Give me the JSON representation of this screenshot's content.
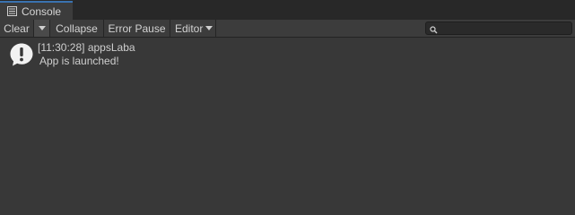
{
  "window": {
    "tab_label": "Console",
    "tab_icon": "console-list-icon"
  },
  "toolbar": {
    "clear_label": "Clear",
    "clear_dropdown_icon": "chevron-down-icon",
    "collapse_label": "Collapse",
    "error_pause_label": "Error Pause",
    "editor_label": "Editor",
    "editor_dropdown_icon": "chevron-down-icon"
  },
  "search": {
    "icon": "search-icon",
    "value": ""
  },
  "log": {
    "entries": [
      {
        "icon": "info-message-icon",
        "header": "[11:30:28] appsLaba",
        "message": "App is launched!"
      }
    ]
  },
  "colors": {
    "background": "#383838",
    "toolbar": "#3c3c3c",
    "tabstrip": "#282828",
    "tab_accent": "#3a72b0",
    "text": "#cfcfcf"
  }
}
